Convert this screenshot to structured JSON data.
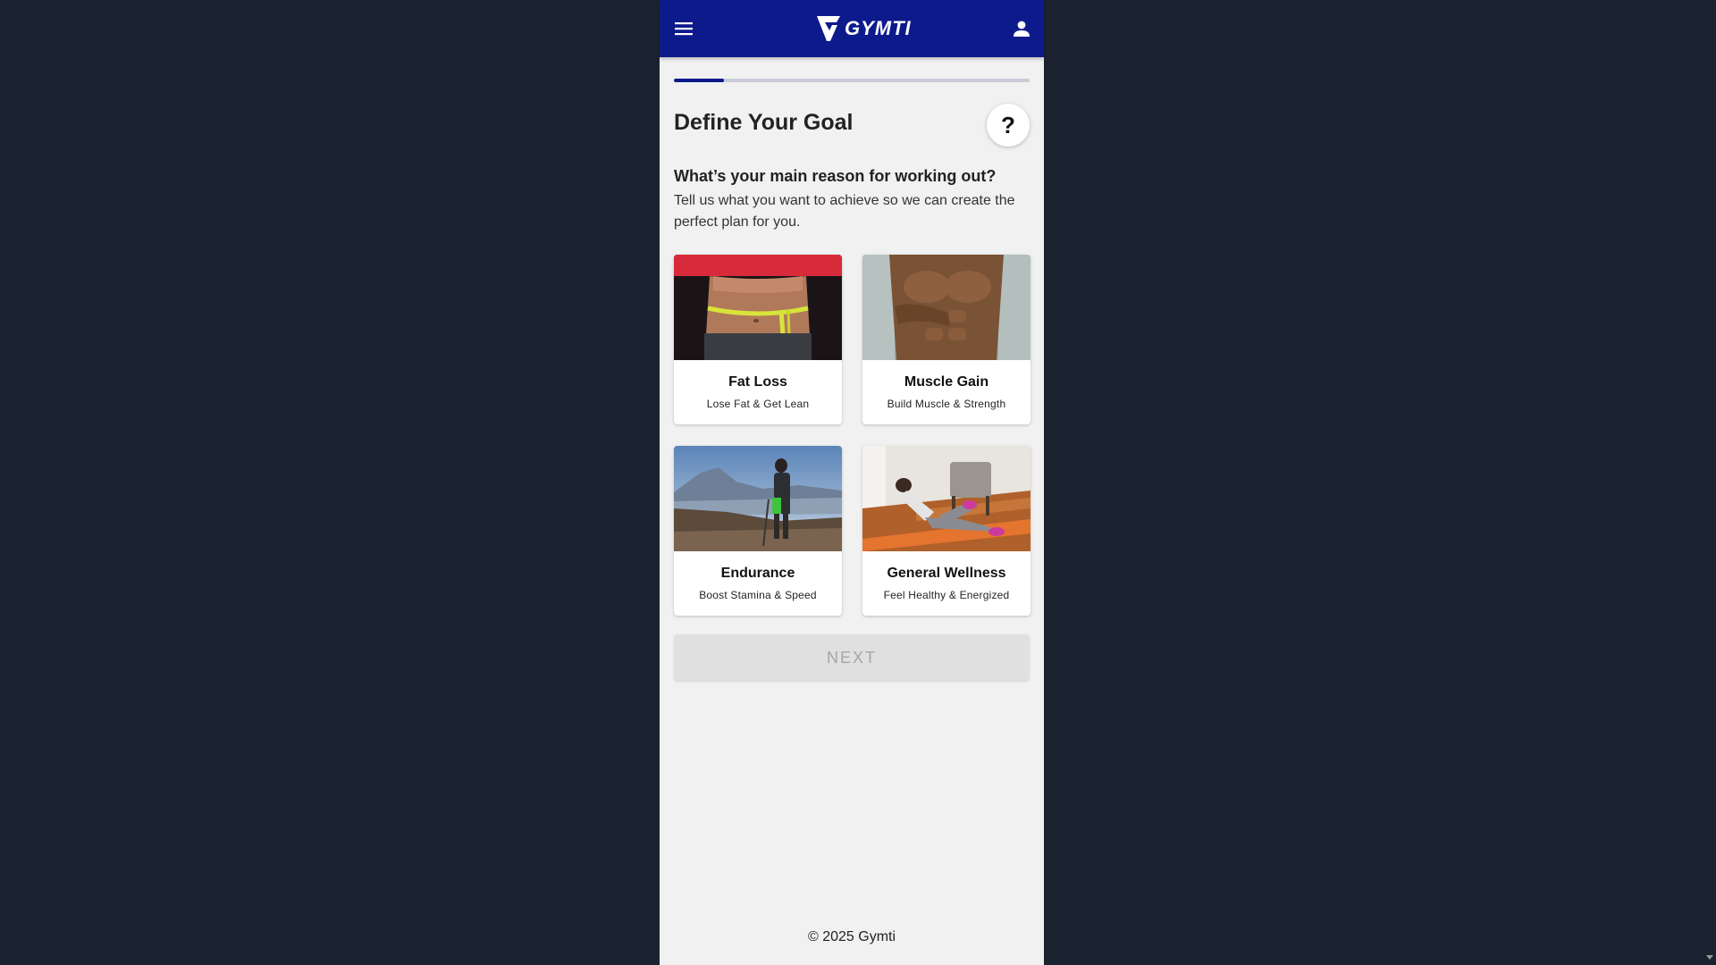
{
  "app": {
    "brand": "GYMTI",
    "colors": {
      "primary": "#0d1a8c",
      "background": "#f1f1f1",
      "outer": "#1b2230"
    }
  },
  "header": {
    "menu_icon": "menu-icon",
    "account_icon": "account-icon",
    "logo_icon": "gymti-logo-icon"
  },
  "progress": {
    "value_percent": 14
  },
  "page": {
    "title": "Define Your Goal",
    "help_label": "?",
    "question": "What’s your main reason for working out?",
    "description": "Tell us what you want to achieve so we can create the perfect plan for you."
  },
  "goals": [
    {
      "title": "Fat Loss",
      "subtitle": "Lose Fat & Get Lean"
    },
    {
      "title": "Muscle Gain",
      "subtitle": "Build Muscle & Strength"
    },
    {
      "title": "Endurance",
      "subtitle": "Boost Stamina & Speed"
    },
    {
      "title": "General Wellness",
      "subtitle": "Feel Healthy & Energized"
    }
  ],
  "actions": {
    "next_label": "NEXT"
  },
  "footer": {
    "copyright": "© 2025 Gymti"
  }
}
